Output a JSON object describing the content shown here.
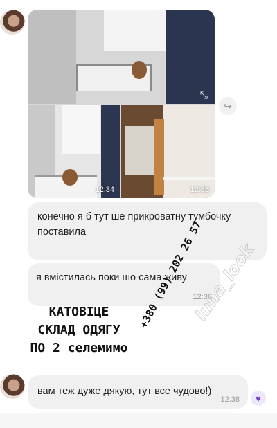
{
  "album": {
    "photos": [
      {
        "time": ""
      },
      {
        "time": "12:34"
      },
      {
        "time": "12:35"
      }
    ]
  },
  "messages": [
    {
      "text": "конечно я б тут ше прикроватну тумбочку поставила",
      "time": ""
    },
    {
      "text": "я вмістилась поки шо сама живу",
      "time": "12:36"
    },
    {
      "text": "вам теж дуже дякую, тут все чудово!)",
      "time": "12:38"
    }
  ],
  "overlay": {
    "line1": "КАТОВІЦЕ",
    "line2": "СКЛАД ОДЯГУ",
    "line3": "ПО 2 селемимо",
    "phone": "+380 (99) 202 26 57"
  },
  "watermark": {
    "text": "luna_look"
  },
  "icons": {
    "forward": "forward-icon",
    "heart": "heart-reaction-icon",
    "expand": "collapse-arrows-icon"
  },
  "colors": {
    "bubble": "#f0f0f0",
    "reaction_accent": "#6b3fd6"
  }
}
